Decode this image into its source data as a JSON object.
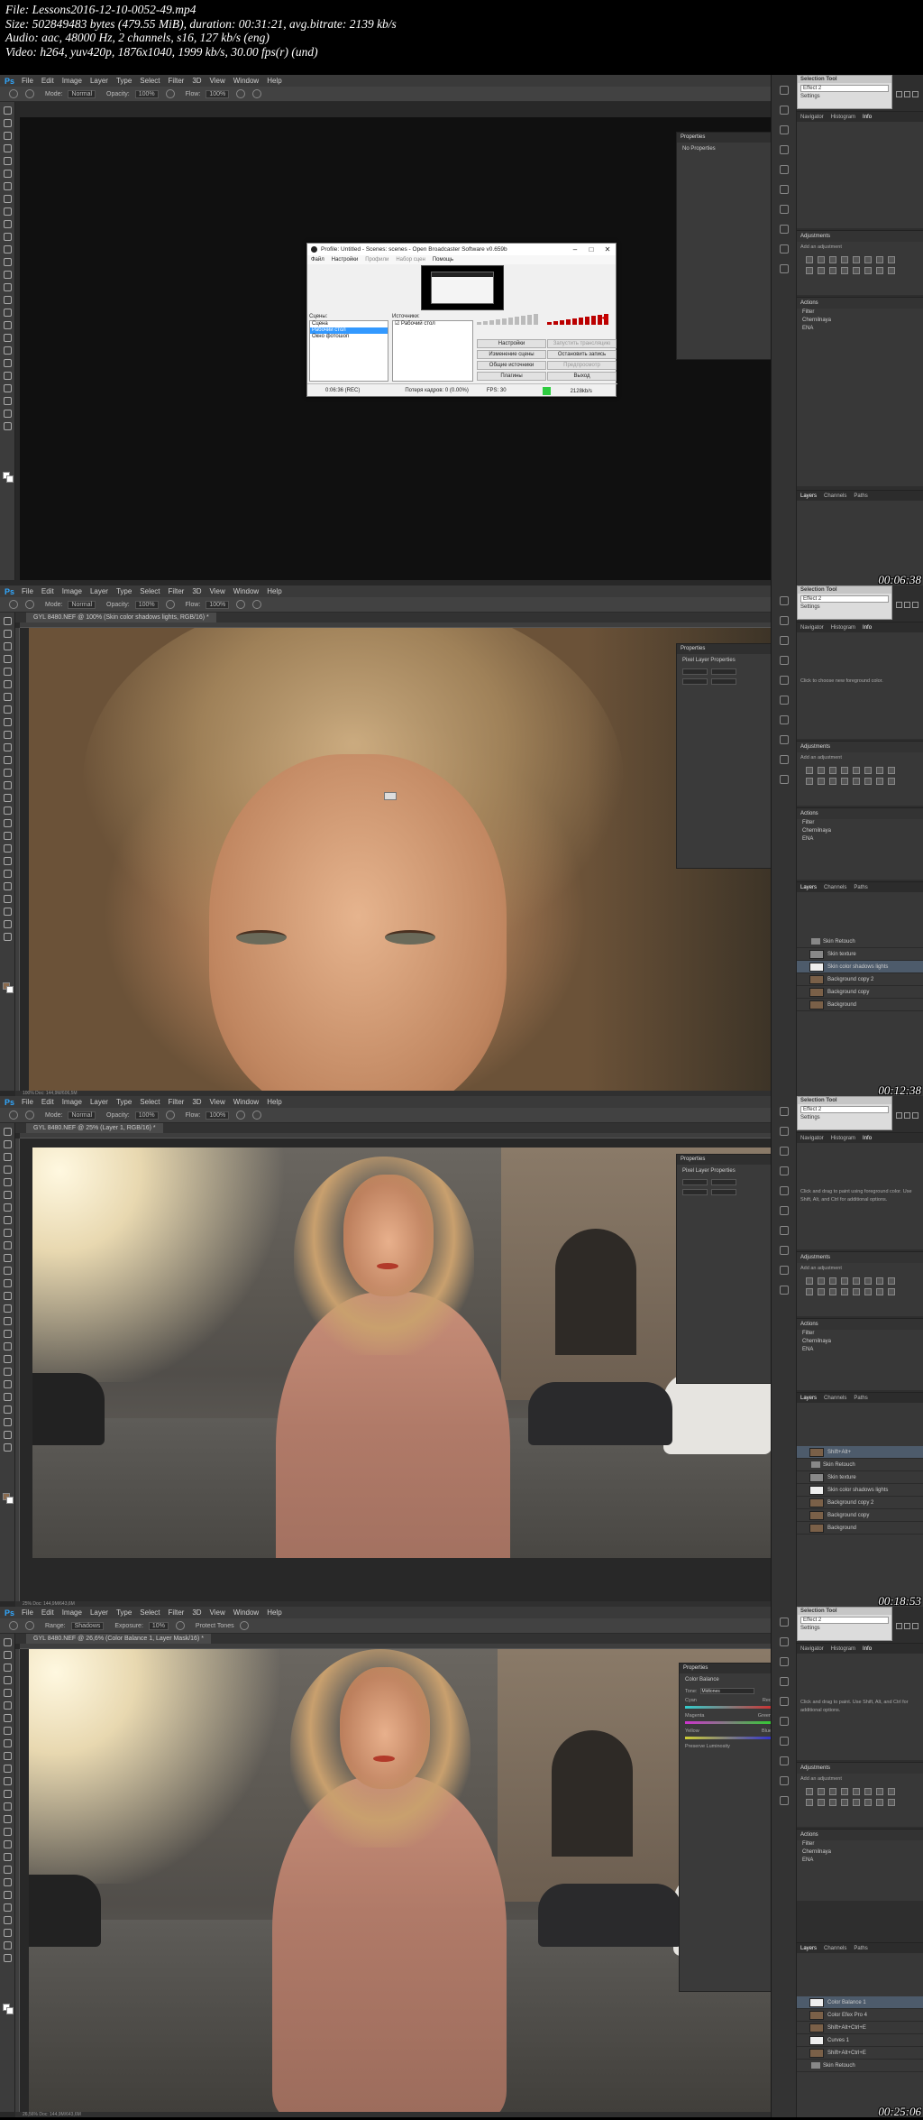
{
  "file_info": {
    "line1": "File: Lessons2016-12-10-0052-49.mp4",
    "line2": "Size: 502849483 bytes (479.55 MiB), duration: 00:31:21, avg.bitrate: 2139 kb/s",
    "line3": "Audio: aac, 48000 Hz, 2 channels, s16, 127 kb/s (eng)",
    "line4": "Video: h264, yuv420p, 1876x1040, 1999 kb/s, 30.00 fps(r) (und)"
  },
  "ps_logo": "Ps",
  "menu": [
    "File",
    "Edit",
    "Image",
    "Layer",
    "Type",
    "Select",
    "Filter",
    "3D",
    "View",
    "Window",
    "Help"
  ],
  "options": {
    "mode_label": "Mode:",
    "mode_value": "Normal",
    "opacity_label": "Opacity:",
    "opacity_value": "100%",
    "flow_label": "Flow:",
    "flow_value": "100%",
    "range_label": "Range:",
    "range_value": "Shadows",
    "exposure_label": "Exposure:",
    "exposure_value": "10%",
    "protect_tones": "Protect Tones"
  },
  "selection_tool": {
    "title": "Selection Tool",
    "field": "Effect 2",
    "settings": "Settings"
  },
  "panel_tabs": {
    "navigator": "Navigator",
    "histogram": "Histogram",
    "info": "Info",
    "adjustments": "Adjustments",
    "add_adjustment": "Add an adjustment",
    "actions": "Actions",
    "layers": "Layers",
    "channels": "Channels",
    "paths": "Paths"
  },
  "actions_items": [
    "Filter",
    "Chernilnaya",
    "ENA"
  ],
  "frames": [
    {
      "timestamp": "00:06:38",
      "doc_tab": "",
      "status": "",
      "properties_title": "Properties",
      "properties_sub": "No Properties",
      "info_text": "",
      "layers": []
    },
    {
      "timestamp": "00:12:38",
      "doc_tab": "GYL 8480.NEF @ 100% (Skin color shadows lights, RGB/16) *",
      "status": "100%   Doc: 144,9M/606,5M",
      "properties_title": "Properties",
      "properties_sub": "Pixel Layer Properties",
      "info_text": "Click to choose new foreground color.",
      "layers": [
        {
          "name": "Skin Retouch",
          "type": "group"
        },
        {
          "name": "Skin texture",
          "type": "gray"
        },
        {
          "name": "Skin color shadows lights",
          "type": "white",
          "selected": true
        },
        {
          "name": "Background copy 2",
          "type": "photo"
        },
        {
          "name": "Background copy",
          "type": "photo"
        },
        {
          "name": "Background",
          "type": "photo"
        }
      ]
    },
    {
      "timestamp": "00:18:53",
      "doc_tab": "GYL 8480.NEF @ 25% (Layer 1, RGB/16) *",
      "status": "25%   Doc: 144,9M/643,6M",
      "properties_title": "Properties",
      "properties_sub": "Pixel Layer Properties",
      "info_text": "Click and drag to paint using foreground color. Use Shift, Alt, and Ctrl for additional options.",
      "layers": [
        {
          "name": "Shift+Alt+",
          "type": "photo",
          "selected": true
        },
        {
          "name": "Skin Retouch",
          "type": "group"
        },
        {
          "name": "Skin texture",
          "type": "gray"
        },
        {
          "name": "Skin color shadows lights",
          "type": "white"
        },
        {
          "name": "Background copy 2",
          "type": "photo"
        },
        {
          "name": "Background copy",
          "type": "photo"
        },
        {
          "name": "Background",
          "type": "photo"
        }
      ]
    },
    {
      "timestamp": "00:25:06",
      "doc_tab": "GYL 8480.NEF @ 26,6% (Color Balance 1, Layer Mask/16) *",
      "status": "26,56%   Doc: 144,9M/643,6M",
      "properties_title": "Properties",
      "properties_sub": "Color Balance",
      "info_text": "Click and drag to paint. Use Shift, Alt, and Ctrl for additional options.",
      "color_balance": {
        "tone_label": "Tone:",
        "tone_value": "Midtones",
        "cyan": "Cyan",
        "red": "Red",
        "magenta": "Magenta",
        "green": "Green",
        "yellow": "Yellow",
        "blue": "Blue",
        "preserve": "Preserve Luminosity"
      },
      "layers": [
        {
          "name": "Color Balance 1",
          "type": "white",
          "selected": true
        },
        {
          "name": "Color Efex Pro 4",
          "type": "photo"
        },
        {
          "name": "Shift+Alt+Ctrl+E",
          "type": "photo"
        },
        {
          "name": "Curves 1",
          "type": "white"
        },
        {
          "name": "Shift+Alt+Ctrl+E",
          "type": "photo"
        },
        {
          "name": "Skin Retouch",
          "type": "group"
        }
      ]
    }
  ],
  "obs": {
    "title": "Profile: Untitled - Scenes: scenes - Open Broadcaster Software v0.659b",
    "menu": [
      "Файл",
      "Настройки",
      "Профили",
      "Набор сцен",
      "Помощь"
    ],
    "scenes_label": "Сцены:",
    "scenes": [
      "Сцена",
      "Рабочий стол",
      "Окно фотошоп"
    ],
    "sources_label": "Источники:",
    "source_item": "Рабочий стол",
    "buttons": [
      "Настройки",
      "Изменение сцены",
      "Общие источники",
      "Плагины"
    ],
    "buttons_right": [
      "Запустить трансляцию",
      "Остановить запись",
      "Предпросмотр",
      "Выход"
    ],
    "status_time": "0:06:36 (REC)",
    "status_dropped": "Потеря кадров: 0 (0.00%)",
    "status_fps": "FPS: 30",
    "status_bitrate": "2128kb/s"
  },
  "colors": {
    "ps_blue": "#31a8ff",
    "obs_selected": "#3399ff",
    "obs_green": "#2ecc40"
  }
}
